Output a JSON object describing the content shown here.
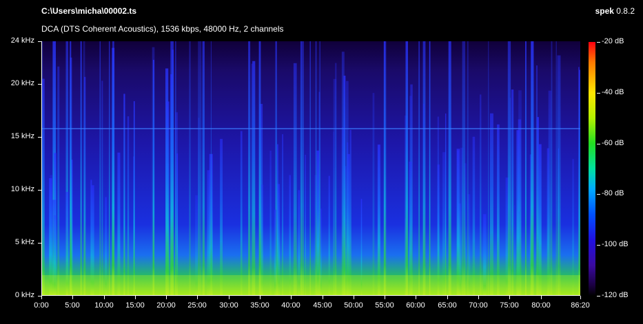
{
  "header": {
    "file_path": "C:\\Users\\micha\\00002.ts",
    "stream_info": "DCA (DTS Coherent Acoustics), 1536 kbps, 48000 Hz, 2 channels",
    "app_name": "spek",
    "app_version": "0.8.2"
  },
  "y_axis": {
    "ticks": [
      "24 kHz",
      "20 kHz",
      "15 kHz",
      "10 kHz",
      "5 kHz",
      "0 kHz"
    ]
  },
  "x_axis": {
    "ticks": [
      "0:00",
      "5:00",
      "10:00",
      "15:00",
      "20:00",
      "25:00",
      "30:00",
      "35:00",
      "40:00",
      "45:00",
      "50:00",
      "55:00",
      "60:00",
      "65:00",
      "70:00",
      "75:00",
      "80:00",
      "86:20"
    ]
  },
  "colorbar": {
    "ticks": [
      "-20 dB",
      "-40 dB",
      "-60 dB",
      "-80 dB",
      "-100 dB",
      "-120 dB"
    ]
  }
}
